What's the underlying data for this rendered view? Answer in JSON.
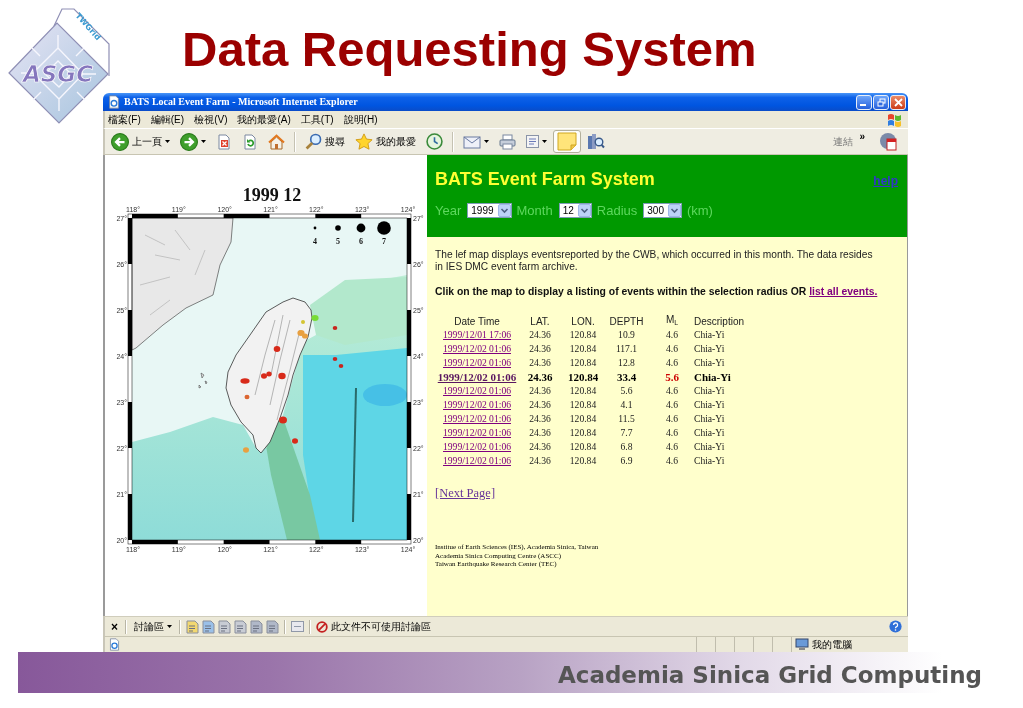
{
  "logo": {
    "mark": "ASGC",
    "tagline": "TWGrid"
  },
  "slide_title": "Data Requesting System",
  "browser": {
    "title": "BATS Local Event Farm - Microsoft Internet Explorer",
    "menu": [
      "檔案(F)",
      "編輯(E)",
      "檢視(V)",
      "我的最愛(A)",
      "工具(T)",
      "說明(H)"
    ],
    "toolbar": [
      [
        {
          "kind": "back",
          "label": "上一頁",
          "dropdown": true,
          "pressed": false
        },
        {
          "kind": "forward",
          "dropdown": true,
          "pressed": false
        },
        {
          "kind": "stop",
          "dropdown": false,
          "pressed": false
        },
        {
          "kind": "refresh",
          "dropdown": false,
          "pressed": false
        },
        {
          "kind": "home",
          "dropdown": false,
          "pressed": false
        }
      ],
      [
        {
          "kind": "search",
          "label": "搜尋",
          "dropdown": false,
          "pressed": false
        },
        {
          "kind": "favorites",
          "label": "我的最愛",
          "dropdown": false,
          "pressed": false
        },
        {
          "kind": "history",
          "dropdown": false,
          "pressed": false
        }
      ],
      [
        {
          "kind": "mail",
          "dropdown": true,
          "pressed": false
        },
        {
          "kind": "print",
          "dropdown": false,
          "pressed": false
        },
        {
          "kind": "edit",
          "dropdown": true,
          "pressed": false
        },
        {
          "kind": "discuss",
          "dropdown": false,
          "pressed": true
        },
        {
          "kind": "research",
          "dropdown": false,
          "pressed": false
        }
      ]
    ],
    "links": {
      "label": "連結",
      "chevron": "»"
    },
    "discussion_bar": {
      "close": "×",
      "label": "討論區",
      "notice": "此文件不可使用討論區"
    },
    "status_bar": {
      "zone": "我的電腦"
    }
  },
  "map": {
    "title": "1999 12",
    "top_ticks": [
      "118°",
      "119°",
      "120°",
      "121°",
      "122°",
      "123°",
      "124°"
    ],
    "bottom_ticks": [
      "118°",
      "119°",
      "120°",
      "121°",
      "122°",
      "123°",
      "124°"
    ],
    "left_ticks": [
      "27°",
      "26°",
      "25°",
      "24°",
      "23°",
      "22°",
      "21°",
      "20°"
    ],
    "right_ticks": [
      "27°",
      "26°",
      "25°",
      "24°",
      "23°",
      "22°",
      "21°",
      "20°"
    ],
    "legend": [
      "4",
      "5",
      "6",
      "7"
    ]
  },
  "panel": {
    "title": "BATS Event Farm System",
    "help": "help",
    "filters": [
      {
        "label": "Year",
        "value": "1999"
      },
      {
        "label": "Month",
        "value": "12"
      },
      {
        "label": "Radius",
        "value": "300"
      }
    ],
    "unit": "(km)",
    "intro": "The lef map displays eventsreported by the CWB, which occurred in this month. The data resides in IES DMC event farm archive.",
    "instruction": "Clik on the map to display a listing of events within the selection radius OR",
    "instruction_link": "list all events.",
    "columns": [
      "Date Time",
      "LAT.",
      "LON.",
      "DEPTH",
      "M$_{L}$",
      "Description"
    ],
    "rows": [
      {
        "date": "1999/12/01 17:06",
        "lat": "24.36",
        "lon": "120.84",
        "depth": "10.9",
        "ml": "4.6",
        "description": "Chia-Yi",
        "selected": false
      },
      {
        "date": "1999/12/02 01:06",
        "lat": "24.36",
        "lon": "120.84",
        "depth": "117.1",
        "ml": "4.6",
        "description": "Chia-Yi",
        "selected": false
      },
      {
        "date": "1999/12/02 01:06",
        "lat": "24.36",
        "lon": "120.84",
        "depth": "12.8",
        "ml": "4.6",
        "description": "Chia-Yi",
        "selected": false
      },
      {
        "date": "1999/12/02 01:06",
        "lat": "24.36",
        "lon": "120.84",
        "depth": "33.4",
        "ml": "5.6",
        "description": "Chia-Yi",
        "selected": true
      },
      {
        "date": "1999/12/02 01:06",
        "lat": "24.36",
        "lon": "120.84",
        "depth": "5.6",
        "ml": "4.6",
        "description": "Chia-Yi",
        "selected": false
      },
      {
        "date": "1999/12/02 01:06",
        "lat": "24.36",
        "lon": "120.84",
        "depth": "4.1",
        "ml": "4.6",
        "description": "Chia-Yi",
        "selected": false
      },
      {
        "date": "1999/12/02 01:06",
        "lat": "24.36",
        "lon": "120.84",
        "depth": "11.5",
        "ml": "4.6",
        "description": "Chia-Yi",
        "selected": false
      },
      {
        "date": "1999/12/02 01:06",
        "lat": "24.36",
        "lon": "120.84",
        "depth": "7.7",
        "ml": "4.6",
        "description": "Chia-Yi",
        "selected": false
      },
      {
        "date": "1999/12/02 01:06",
        "lat": "24.36",
        "lon": "120.84",
        "depth": "6.8",
        "ml": "4.6",
        "description": "Chia-Yi",
        "selected": false
      },
      {
        "date": "1999/12/02 01:06",
        "lat": "24.36",
        "lon": "120.84",
        "depth": "6.9",
        "ml": "4.6",
        "description": "Chia-Yi",
        "selected": false
      }
    ],
    "next_page": "[Next Page]",
    "credits": [
      "Institue of Earth Sciences (IES), Academia Sinica, Taiwan",
      "Academia Sinica Computing Centre (ASCC)",
      "Taiwan Earthquake Research Center (TEC)"
    ]
  },
  "footer": "Academia Sinica Grid Computing"
}
